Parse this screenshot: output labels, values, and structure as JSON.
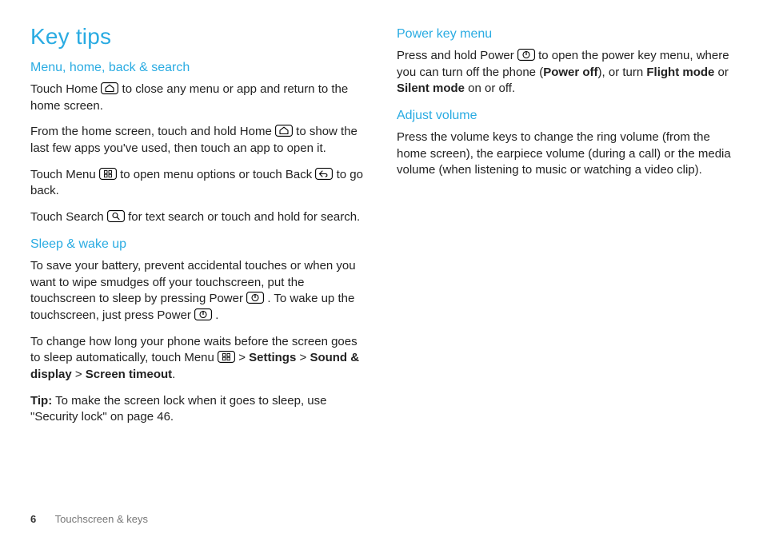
{
  "page": {
    "title": "Key tips",
    "footer_page_number": "6",
    "footer_section": "Touchscreen & keys"
  },
  "left": {
    "section1": {
      "heading": "Menu, home, back & search",
      "p1a": "Touch Home ",
      "p1b": " to close any menu or app and return to the home screen.",
      "p2a": "From the home screen, touch and hold Home ",
      "p2b": " to show the last few apps you've used, then touch an app to open it.",
      "p3a": "Touch Menu ",
      "p3b": " to open menu options or touch Back ",
      "p3c": " to go back.",
      "p4a": "Touch Search ",
      "p4b": " for text search or touch and hold for search."
    },
    "section2": {
      "heading": "Sleep & wake up",
      "p1a": "To save your battery, prevent accidental touches or when you want to wipe smudges off your touchscreen, put the touchscreen to sleep by pressing Power ",
      "p1b": ". To wake up the touchscreen, just press Power ",
      "p1c": ".",
      "p2a": "To change how long your phone waits before the screen goes to sleep automatically, touch Menu ",
      "p2b": " > ",
      "p2_settings": "Settings",
      "p2_gt1": " > ",
      "p2_sound": "Sound & display",
      "p2_gt2": " > ",
      "p2_timeout": "Screen timeout",
      "p2_end": ".",
      "tip_label": "Tip:",
      "tip_text": " To make the screen lock when it goes to sleep, use \"Security lock\" on page 46."
    }
  },
  "right": {
    "section1": {
      "heading": "Power key menu",
      "p1a": "Press and hold Power ",
      "p1b": " to open the power key menu, where you can turn off the phone (",
      "p1_poweroff": "Power off",
      "p1c": "), or turn ",
      "p1_flight": "Flight mode",
      "p1d": " or ",
      "p1_silent": "Silent mode",
      "p1e": " on or off."
    },
    "section2": {
      "heading": "Adjust volume",
      "p1": "Press the volume keys to change the ring volume (from the home screen), the earpiece volume (during a call) or the media volume (when listening to music or watching a video clip)."
    }
  }
}
